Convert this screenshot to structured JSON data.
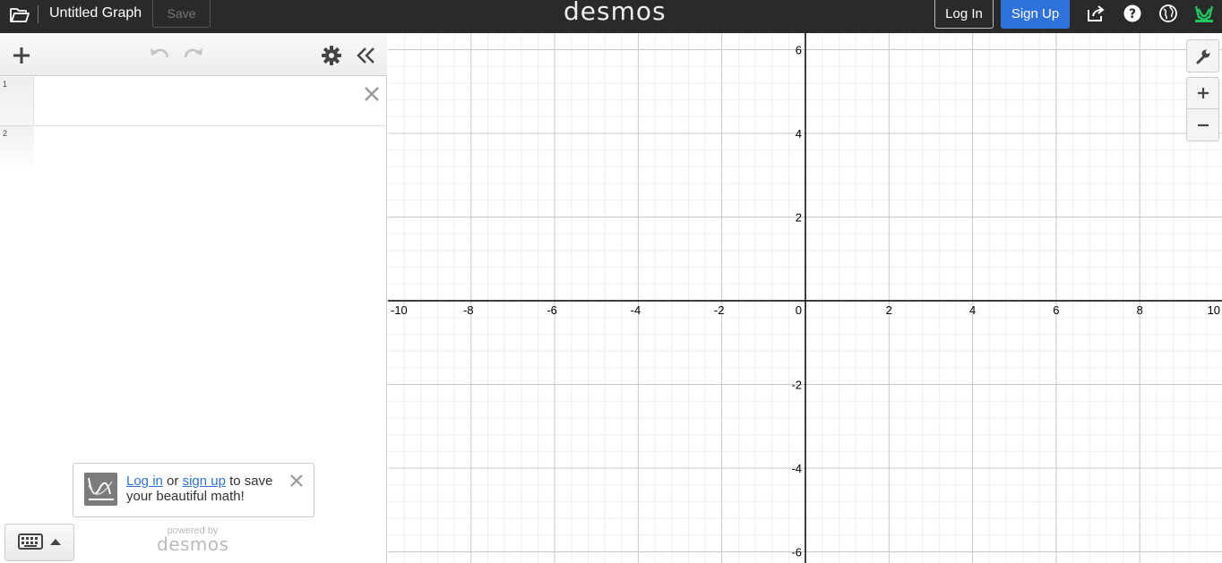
{
  "topbar": {
    "title": "Untitled Graph",
    "save_label": "Save",
    "logo": "desmos",
    "login_label": "Log In",
    "signup_label": "Sign Up",
    "icons": [
      "folder-icon",
      "share-icon",
      "help-icon",
      "globe-icon",
      "user-avatar-icon"
    ]
  },
  "expressions": {
    "toolbar_icons": [
      "add-icon",
      "undo-icon",
      "redo-icon",
      "settings-gear-icon",
      "collapse-chevron-icon"
    ],
    "rows": [
      {
        "index": "1",
        "value": ""
      },
      {
        "index": "2",
        "value": ""
      }
    ]
  },
  "toast": {
    "login_link": "Log in",
    "or_text": " or ",
    "signup_link": "sign up",
    "message": " to save your beautiful math!"
  },
  "powered": {
    "by": "powered by",
    "logo": "desmos"
  },
  "graph": {
    "x_range": [
      -10,
      10
    ],
    "y_range": [
      -6.3,
      6.3
    ],
    "x_major_step": 2,
    "y_major_step": 2,
    "minor_subdivisions": 5,
    "x_ticks": [
      "-10",
      "-8",
      "-6",
      "-4",
      "-2",
      "0",
      "2",
      "4",
      "6",
      "8",
      "10"
    ],
    "y_ticks": [
      "6",
      "4",
      "2",
      "-2",
      "-4",
      "-6"
    ],
    "tools": [
      "wrench-icon",
      "zoom-in-icon",
      "zoom-out-icon"
    ],
    "colors": {
      "minor_grid": "#ededed",
      "major_grid": "#c8c8c8",
      "axis": "#000000"
    }
  },
  "colors": {
    "accent": "#2f72dc",
    "topbar": "#2a2a2a"
  }
}
